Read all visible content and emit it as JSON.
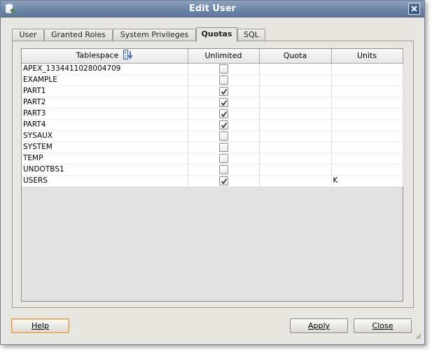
{
  "window": {
    "title": "Edit User"
  },
  "tabs": [
    {
      "label": "User",
      "active": false
    },
    {
      "label": "Granted Roles",
      "active": false
    },
    {
      "label": "System Privileges",
      "active": false
    },
    {
      "label": "Quotas",
      "active": true
    },
    {
      "label": "SQL",
      "active": false
    }
  ],
  "table": {
    "columns": [
      "Tablespace",
      "Unlimited",
      "Quota",
      "Units"
    ],
    "rows": [
      {
        "tablespace": "APEX_1334411028004709",
        "unlimited": false,
        "quota": "",
        "units": ""
      },
      {
        "tablespace": "EXAMPLE",
        "unlimited": false,
        "quota": "",
        "units": ""
      },
      {
        "tablespace": "PART1",
        "unlimited": true,
        "quota": "",
        "units": ""
      },
      {
        "tablespace": "PART2",
        "unlimited": true,
        "quota": "",
        "units": ""
      },
      {
        "tablespace": "PART3",
        "unlimited": true,
        "quota": "",
        "units": ""
      },
      {
        "tablespace": "PART4",
        "unlimited": true,
        "quota": "",
        "units": ""
      },
      {
        "tablespace": "SYSAUX",
        "unlimited": false,
        "quota": "",
        "units": ""
      },
      {
        "tablespace": "SYSTEM",
        "unlimited": false,
        "quota": "",
        "units": ""
      },
      {
        "tablespace": "TEMP",
        "unlimited": false,
        "quota": "",
        "units": ""
      },
      {
        "tablespace": "UNDOTBS1",
        "unlimited": false,
        "quota": "",
        "units": ""
      },
      {
        "tablespace": "USERS",
        "unlimited": true,
        "quota": "",
        "units": "K"
      }
    ]
  },
  "buttons": {
    "help": "Help",
    "apply": "Apply",
    "close": "Close"
  },
  "icons": {
    "app": "database-user-icon",
    "close": "close-icon",
    "sort": "sort-az-icon",
    "grip": "resize-grip-icon"
  },
  "colors": {
    "titlebar": "#6a82a3",
    "window_bg": "#e8e6e1",
    "help_focus": "#d19a4f"
  }
}
